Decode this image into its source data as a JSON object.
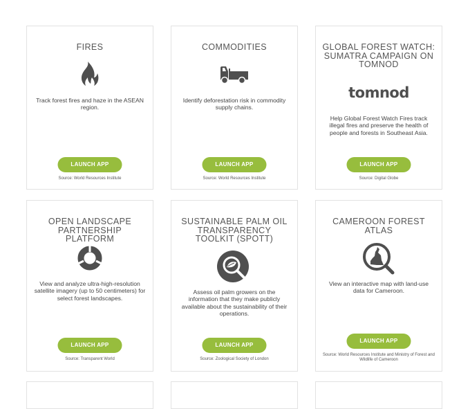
{
  "cards": [
    {
      "title": "Fires",
      "description": "Track forest fires and haze in the ASEAN region.",
      "button": "LAUNCH APP",
      "source": "Source: World Resources Institute",
      "icon": "flame-icon"
    },
    {
      "title": "Commodities",
      "description": "Identify deforestation risk in commodity supply chains.",
      "button": "LAUNCH APP",
      "source": "Source: World Resources Institute",
      "icon": "truck-icon"
    },
    {
      "title": "Global Forest Watch: Sumatra Campaign on Tomnod",
      "logo_text": "tomnod",
      "description": "Help Global Forest Watch Fires track illegal fires and preserve the health of people and forests in Southeast Asia.",
      "button": "LAUNCH APP",
      "source": "Source: Digital Globe",
      "icon": "tomnod-logo"
    },
    {
      "title": "Open Landscape Partnership Platform",
      "description": "View and analyze ultra-high-resolution satellite imagery (up to 50 centimeters) for select forest landscapes.",
      "button": "LAUNCH APP",
      "source": "Source: Transparent World",
      "icon": "ring-icon"
    },
    {
      "title": "Sustainable Palm Oil Transparency Toolkit (SPOTT)",
      "description": "Assess oil palm growers on the information that they make publicly available about the sustainability of their operations.",
      "button": "LAUNCH APP",
      "source": "Source: Zoological Society of London",
      "icon": "magnifier-leaf-icon"
    },
    {
      "title": "Cameroon Forest Atlas",
      "description": "View an interactive map with land-use data for Cameroon.",
      "button": "LAUNCH APP",
      "source": "Source: World Resources Institute and Ministry of Forest and Wildlife of Cameroon",
      "icon": "magnifier-map-icon"
    }
  ],
  "colors": {
    "button": "#97bd3d",
    "icon": "#4f4f4f",
    "border": "#e2e2e2"
  }
}
